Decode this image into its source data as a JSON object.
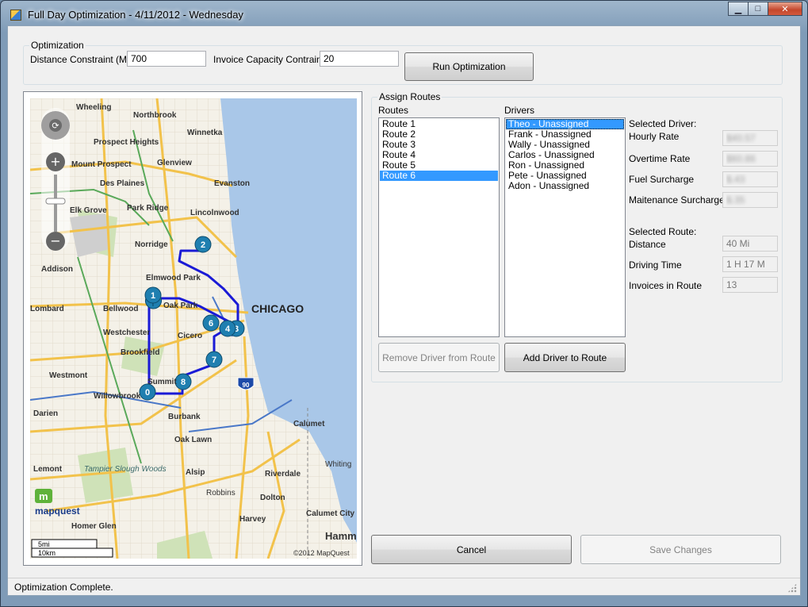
{
  "window": {
    "title": "Full Day Optimization - 4/11/2012 - Wednesday",
    "controls": {
      "minimize": "▁",
      "maximize": "□",
      "close": "✕"
    }
  },
  "optimization": {
    "group_label": "Optimization",
    "distance_label": "Distance Constraint (Mi)",
    "distance_value": "700",
    "invoice_label": "Invoice Capacity Contraint",
    "invoice_value": "20",
    "run_button": "Run Optimization"
  },
  "map": {
    "city_labels": [
      "Wheeling",
      "Northbrook",
      "Winnetka",
      "Prospect Heights",
      "Glenview",
      "Mount Prospect",
      "Des Plaines",
      "Evanston",
      "Elk Grove",
      "Park Ridge",
      "Lincolnwood",
      "Norridge",
      "Addison",
      "Elmwood Park",
      "Oak Park",
      "Lombard",
      "Bellwood",
      "CHICAGO",
      "Westchester",
      "Cicero",
      "Brookfield",
      "Westmont",
      "Summit",
      "Willowbrook",
      "Darien",
      "Burbank",
      "Oak Lawn",
      "Calumet",
      "Lemont",
      "Tampier Slough Woods",
      "Alsip",
      "Riverdale",
      "Whiting",
      "Robbins",
      "Dolton",
      "Harvey",
      "Calumet City",
      "Homer Glen",
      "Hamm"
    ],
    "markers": [
      "1",
      "2",
      "0",
      "8",
      "7",
      "6",
      "4",
      "3"
    ],
    "logo": "mapquest",
    "copyright": "©2012 MapQuest",
    "scale": [
      "5mi",
      "10km"
    ],
    "highway": "90"
  },
  "assign": {
    "group_label": "Assign Routes",
    "routes_label": "Routes",
    "drivers_label": "Drivers",
    "routes": [
      "Route 1",
      "Route 2",
      "Route 3",
      "Route 4",
      "Route 5",
      "Route 6"
    ],
    "selected_route_index": 5,
    "drivers": [
      "Theo - Unassigned",
      "Frank - Unassigned",
      "Wally - Unassigned",
      "Carlos - Unassigned",
      "Ron - Unassigned",
      "Pete - Unassigned",
      "Adon - Unassigned"
    ],
    "selected_driver_index": 0,
    "remove_button": "Remove Driver from Route",
    "add_button": "Add Driver to Route",
    "selected_driver_title": "Selected Driver:",
    "hourly_rate_label": "Hourly Rate",
    "hourly_rate_value": "$40.57",
    "overtime_rate_label": "Overtime Rate",
    "overtime_rate_value": "$60.86",
    "fuel_label": "Fuel Surcharge",
    "fuel_value": "$.43",
    "maint_label": "Maitenance Surcharge",
    "maint_value": "$.35",
    "selected_route_title": "Selected Route:",
    "distance_label": "Distance",
    "distance_value": "40 Mi",
    "driving_label": "Driving Time",
    "driving_value": "1 H 17 M",
    "invoices_label": "Invoices in Route",
    "invoices_value": "13"
  },
  "footer": {
    "cancel_button": "Cancel",
    "save_button": "Save Changes",
    "status": "Optimization Complete."
  },
  "colors": {
    "route_line": "#1a1ad6",
    "marker": "#1f7fb0",
    "water": "#a9c7e8",
    "selection": "#3399ff"
  }
}
